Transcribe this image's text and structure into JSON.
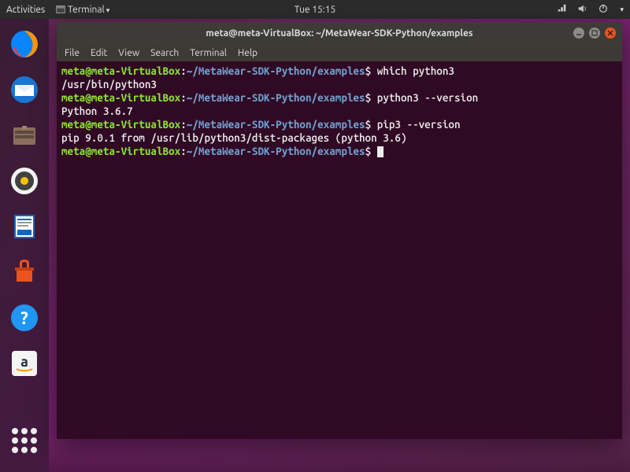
{
  "topbar": {
    "activities": "Activities",
    "app_indicator": "Terminal",
    "clock": "Tue 15:15"
  },
  "dock": {
    "items": [
      {
        "name": "firefox-icon"
      },
      {
        "name": "thunderbird-icon"
      },
      {
        "name": "files-icon"
      },
      {
        "name": "rhythmbox-icon"
      },
      {
        "name": "writer-icon"
      },
      {
        "name": "software-icon"
      },
      {
        "name": "help-icon"
      },
      {
        "name": "amazon-icon"
      }
    ]
  },
  "window": {
    "title": "meta@meta-VirtualBox: ~/MetaWear-SDK-Python/examples",
    "menu": {
      "file": "File",
      "edit": "Edit",
      "view": "View",
      "search": "Search",
      "terminal": "Terminal",
      "help": "Help"
    }
  },
  "terminal": {
    "prompt_user": "meta@meta-VirtualBox",
    "prompt_sep": ":",
    "prompt_path": "~/MetaWear-SDK-Python/examples",
    "prompt_end": "$",
    "lines": [
      {
        "cmd": "which python3",
        "out": "/usr/bin/python3"
      },
      {
        "cmd": "python3 --version",
        "out": "Python 3.6.7"
      },
      {
        "cmd": "pip3 --version",
        "out": "pip 9.0.1 from /usr/lib/python3/dist-packages (python 3.6)"
      }
    ]
  }
}
